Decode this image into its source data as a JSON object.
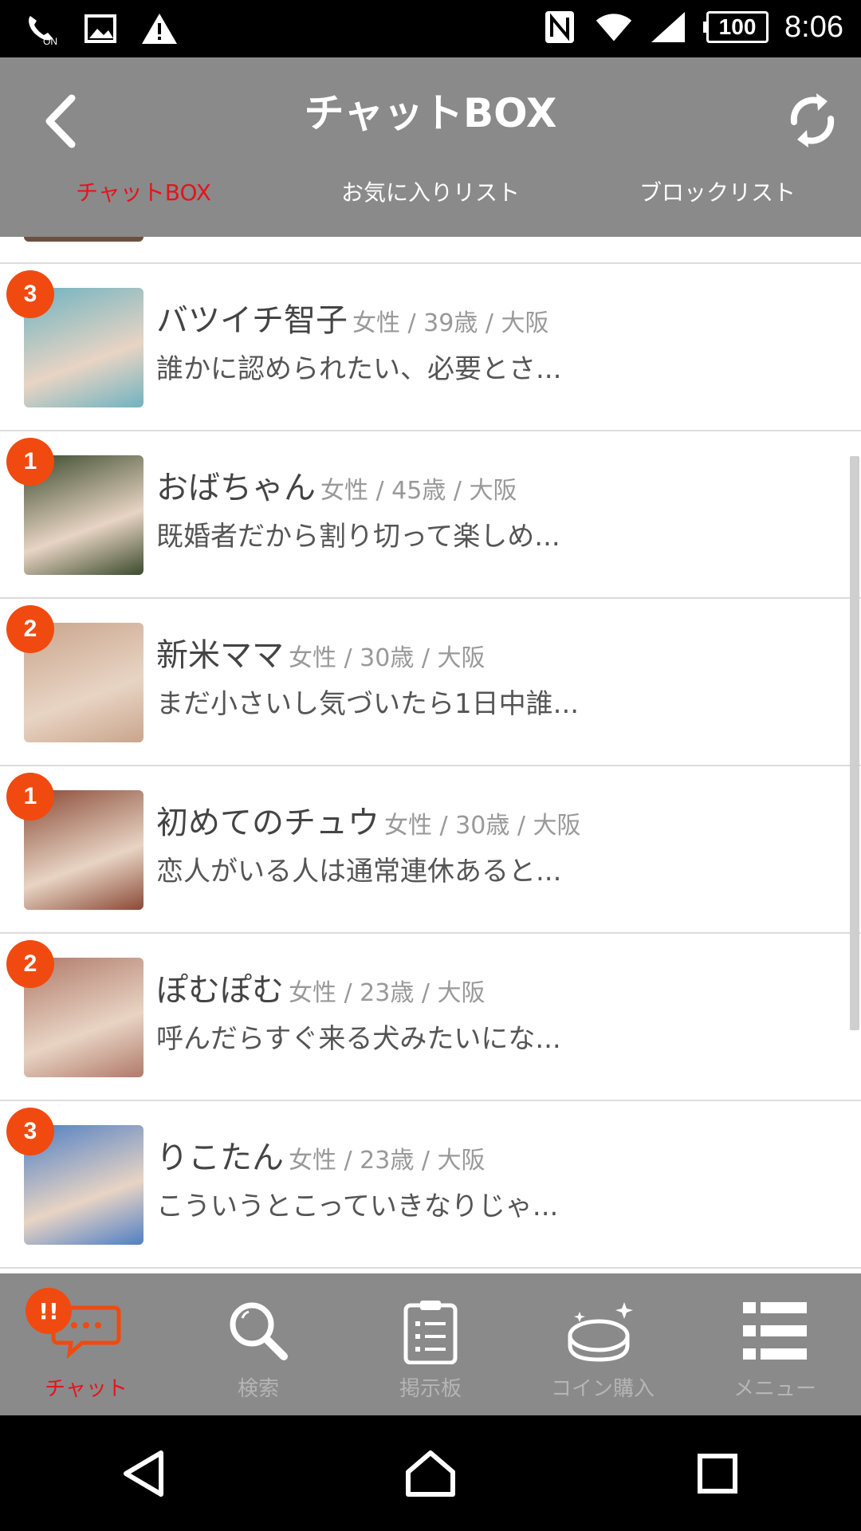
{
  "status_bar": {
    "icons": [
      "wifi-calling-on-icon",
      "image-icon",
      "warning-icon",
      "nfc-icon",
      "wifi-icon",
      "signal-icon"
    ],
    "battery": "100",
    "time": "8:06"
  },
  "header": {
    "title": "チャットBOX",
    "tabs": [
      {
        "label": "チャットBOX",
        "active": true
      },
      {
        "label": "お気に入りリスト",
        "active": false
      },
      {
        "label": "ブロックリスト",
        "active": false
      }
    ]
  },
  "chats": [
    {
      "name": "バツイチ智子",
      "meta": "女性 / 39歳 / 大阪",
      "message": "誰かに認められたい、必要とさ...",
      "unread": "3",
      "avatar_color": "#6fb3c0"
    },
    {
      "name": "おばちゃん",
      "meta": "女性 / 45歳 / 大阪",
      "message": "既婚者だから割り切って楽しめ...",
      "unread": "1",
      "avatar_color": "#3a4a2c"
    },
    {
      "name": "新米ママ",
      "meta": "女性 / 30歳 / 大阪",
      "message": "まだ小さいし気づいたら1日中誰...",
      "unread": "2",
      "avatar_color": "#c9a58c"
    },
    {
      "name": "初めてのチュウ",
      "meta": "女性 / 30歳 / 大阪",
      "message": "恋人がいる人は通常連休あると...",
      "unread": "1",
      "avatar_color": "#8a4a36"
    },
    {
      "name": "ぽむぽむ",
      "meta": "女性 / 23歳 / 大阪",
      "message": "呼んだらすぐ来る犬みたいにな...",
      "unread": "2",
      "avatar_color": "#b07a6a"
    },
    {
      "name": "りこたん",
      "meta": "女性 / 23歳 / 大阪",
      "message": "こういうとこっていきなりじゃ...",
      "unread": "3",
      "avatar_color": "#4f7fc4"
    }
  ],
  "bottom_nav": [
    {
      "label": "チャット",
      "icon": "chat-bubble-icon",
      "active": true,
      "badge": "!!"
    },
    {
      "label": "検索",
      "icon": "search-icon",
      "active": false
    },
    {
      "label": "掲示板",
      "icon": "clipboard-icon",
      "active": false
    },
    {
      "label": "コイン購入",
      "icon": "coin-icon",
      "active": false
    },
    {
      "label": "メニュー",
      "icon": "menu-list-icon",
      "active": false
    }
  ],
  "system_nav": [
    "back-icon",
    "home-icon",
    "recents-icon"
  ]
}
